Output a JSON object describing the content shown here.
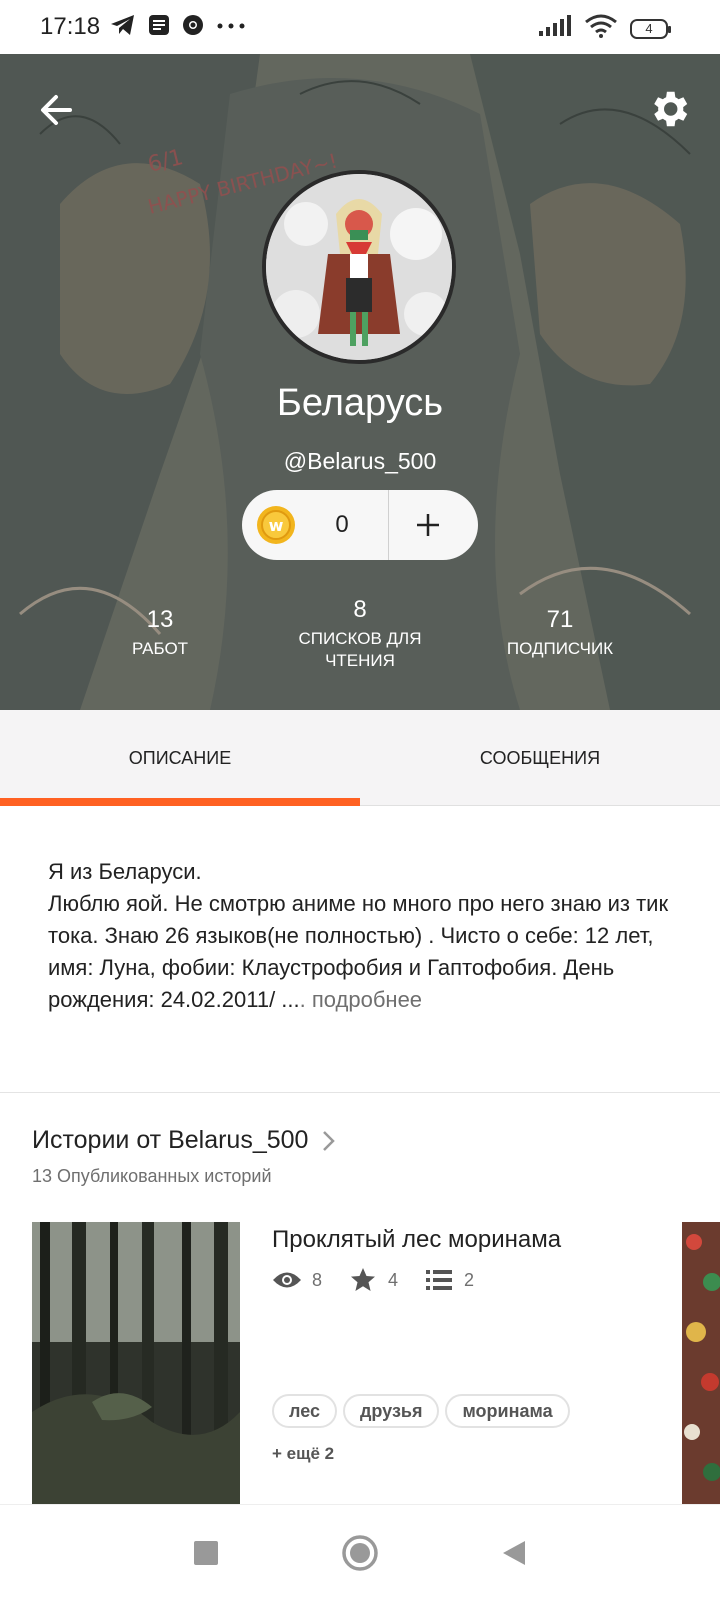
{
  "status_bar": {
    "time": "17:18",
    "left_icons": [
      "telegram-icon",
      "notes-icon",
      "chrome-icon",
      "more-dots-icon"
    ],
    "right_icons": [
      "signal-icon",
      "wifi-icon"
    ],
    "battery_level": "4"
  },
  "header": {
    "back_icon": "arrow-left-icon",
    "settings_icon": "gear-icon",
    "display_name": "Беларусь",
    "username": "@Belarus_500",
    "coins": {
      "count": "0",
      "coin_icon": "wattpad-coin-icon",
      "add_icon": "plus-icon"
    },
    "stats": [
      {
        "value": "13",
        "label": "РАБОТ"
      },
      {
        "value": "8",
        "label": "СПИСКОВ ДЛЯ ЧТЕНИЯ"
      },
      {
        "value": "71",
        "label": "ПОДПИСЧИК"
      }
    ]
  },
  "tabs": [
    {
      "label": "ОПИСАНИЕ",
      "active": true
    },
    {
      "label": "СООБЩЕНИЯ",
      "active": false
    }
  ],
  "description": {
    "text": "Я из Беларуси.\nЛюблю яой. Не смотрю аниме но много про него знаю из тик тока. Знаю 26 языков(не полностью) . Чисто о себе: 12 лет, имя: Луна, фобии: Клаустрофобия и Гаптофобия. День рождения: 24.02.2011/ ...",
    "more_label": ". подробнее"
  },
  "stories": {
    "title": "Истории от Belarus_500",
    "subtitle": "13 Опубликованных историй",
    "items": [
      {
        "title": "Проклятый лес моринама",
        "reads": "8",
        "votes": "4",
        "parts": "2",
        "tags": [
          "лес",
          "друзья",
          "моринама"
        ],
        "more_tags": "+ ещё 2"
      }
    ]
  },
  "accent_color": "#ff6122",
  "nav_bar": {
    "buttons": [
      "recent-apps-icon",
      "home-icon",
      "back-triangle-icon"
    ]
  }
}
